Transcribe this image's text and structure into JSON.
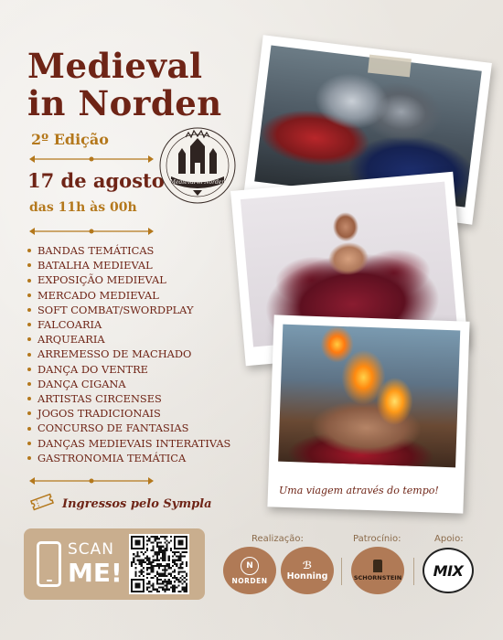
{
  "poster": {
    "title_line1": "Medieval",
    "title_line2": "in Norden",
    "edition": "2º Edição",
    "date": "17 de agosto",
    "hours": "das 11h às 00h",
    "seal_text": "Medieval in Norden"
  },
  "activities": [
    "BANDAS TEMÁTICAS",
    "BATALHA MEDIEVAL",
    "EXPOSIÇÃO MEDIEVAL",
    "MERCADO MEDIEVAL",
    "SOFT COMBAT/SWORDPLAY",
    "FALCOARIA",
    "ARQUEARIA",
    "ARREMESSO DE MACHADO",
    "DANÇA DO VENTRE",
    "DANÇA CIGANA",
    "ARTISTAS CIRCENSES",
    "JOGOS TRADICIONAIS",
    "CONCURSO DE FANTASIAS",
    "DANÇAS MEDIEVAIS INTERATIVAS",
    "GASTRONOMIA TEMÁTICA"
  ],
  "tickets": {
    "text": "Ingressos pelo Sympla",
    "icon": "ticket-icon"
  },
  "scan": {
    "line1": "SCAN",
    "line2": "ME!"
  },
  "sponsors": {
    "realizacao_label": "Realização:",
    "patrocinio_label": "Patrocínio:",
    "apoio_label": "Apoio:",
    "norden": "NORDEN",
    "honning": "Honning",
    "schornstein": "SCHORNSTEIN",
    "mix": "MIX"
  },
  "caption": "Uma viagem através do tempo!",
  "colors": {
    "primary": "#6e2416",
    "accent": "#b4781c",
    "scan_box": "#c9ae8e",
    "background": "#eeebe6"
  }
}
